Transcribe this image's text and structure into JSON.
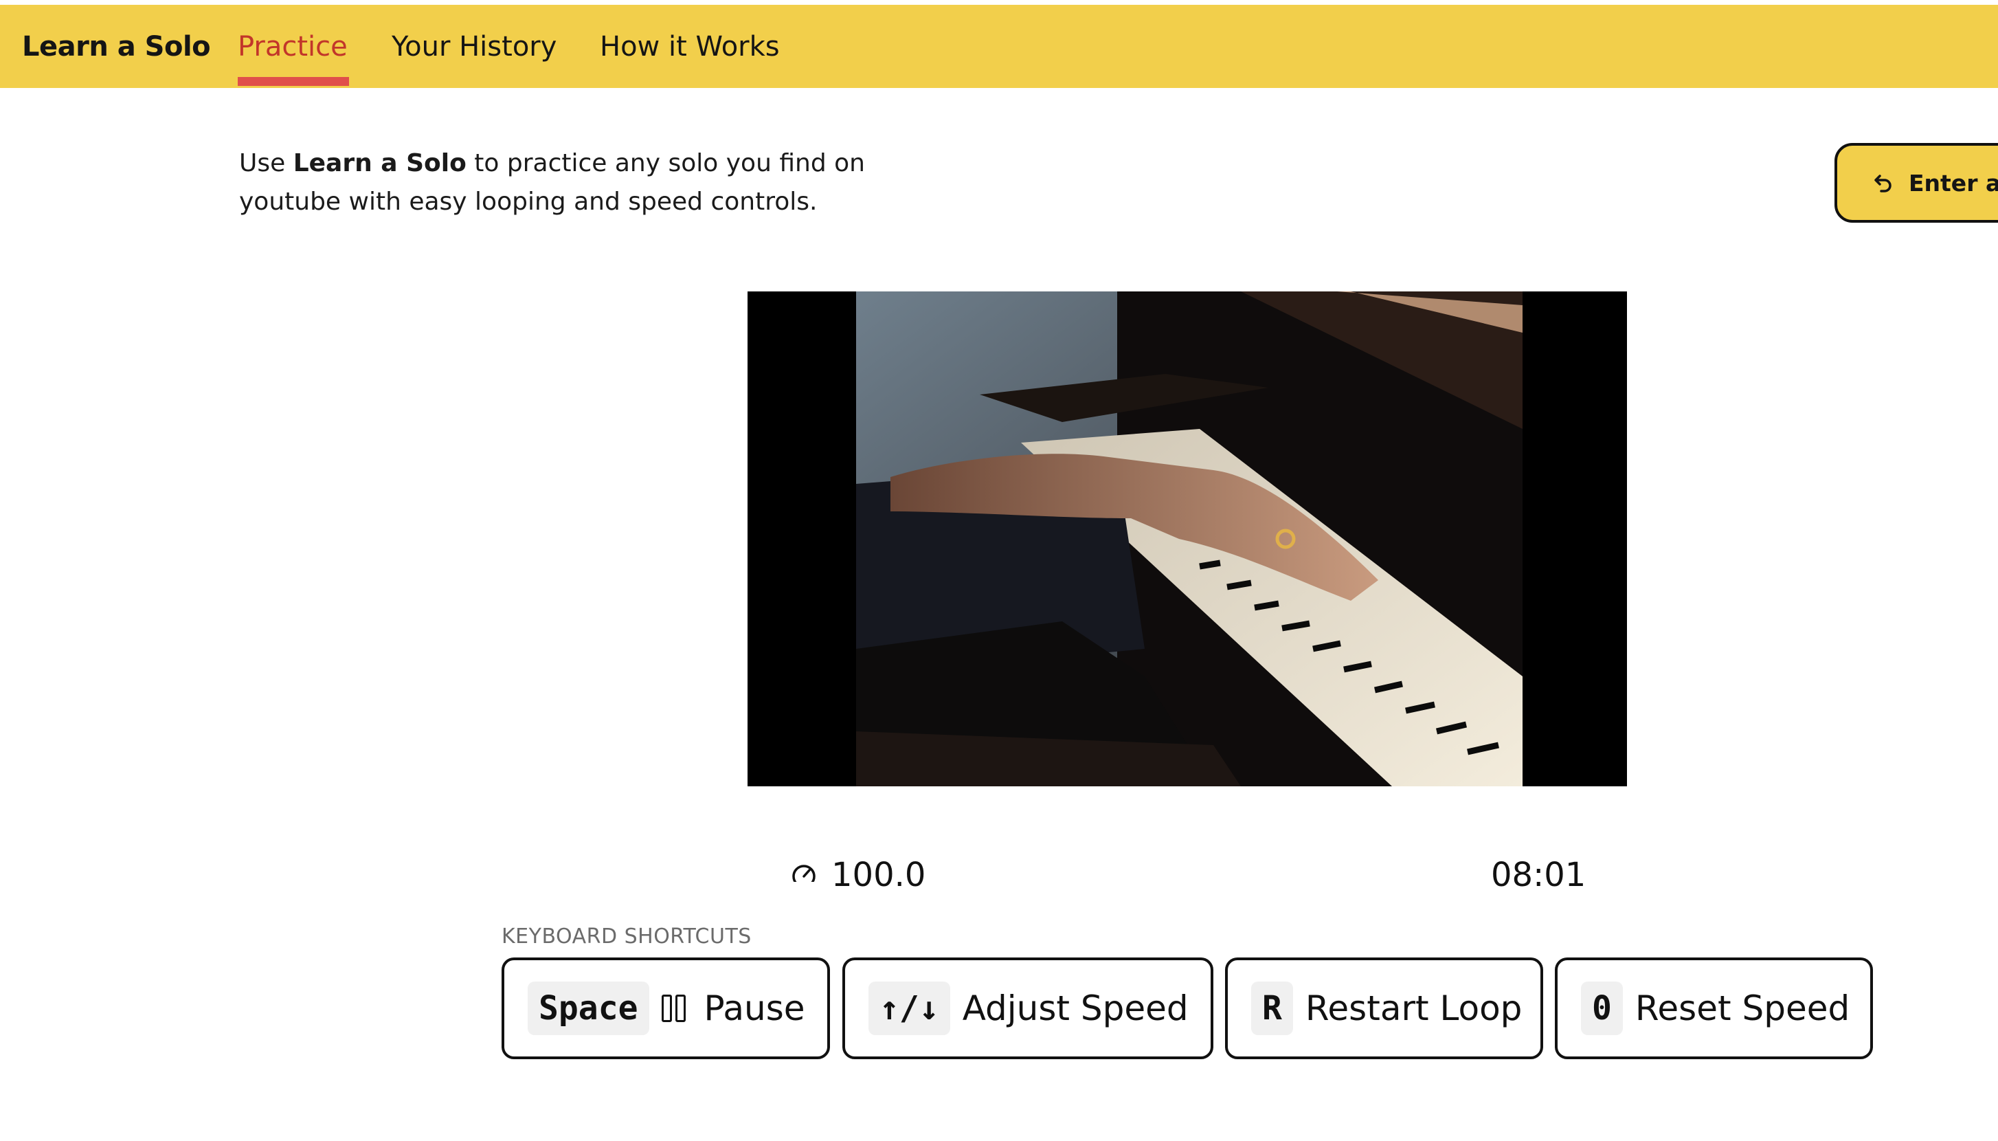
{
  "nav": {
    "brand": "Learn a Solo",
    "tabs": [
      {
        "label": "Practice",
        "active": true
      },
      {
        "label": "Your History",
        "active": false
      },
      {
        "label": "How it Works",
        "active": false
      }
    ]
  },
  "intro": {
    "prefix": "Use ",
    "brand": "Learn a Solo",
    "suffix": " to practice any solo you find on youtube with easy looping and speed controls."
  },
  "enter_button": {
    "label": "Enter a V",
    "icon": "undo-arrow-icon"
  },
  "player": {
    "speed": "100.0",
    "speed_icon": "gauge-icon",
    "time": "08:01"
  },
  "shortcuts": {
    "title": "KEYBOARD SHORTCUTS",
    "items": [
      {
        "key": "Space",
        "icon": "pause-icon",
        "label": "Pause"
      },
      {
        "key": "↑/↓",
        "label": "Adjust Speed"
      },
      {
        "key": "R",
        "label": "Restart Loop"
      },
      {
        "key": "0",
        "label": "Reset Speed"
      }
    ]
  },
  "colors": {
    "nav_bg": "#f2cf4b",
    "active_tab": "#c2362a",
    "tab_underline": "#e0504a"
  }
}
